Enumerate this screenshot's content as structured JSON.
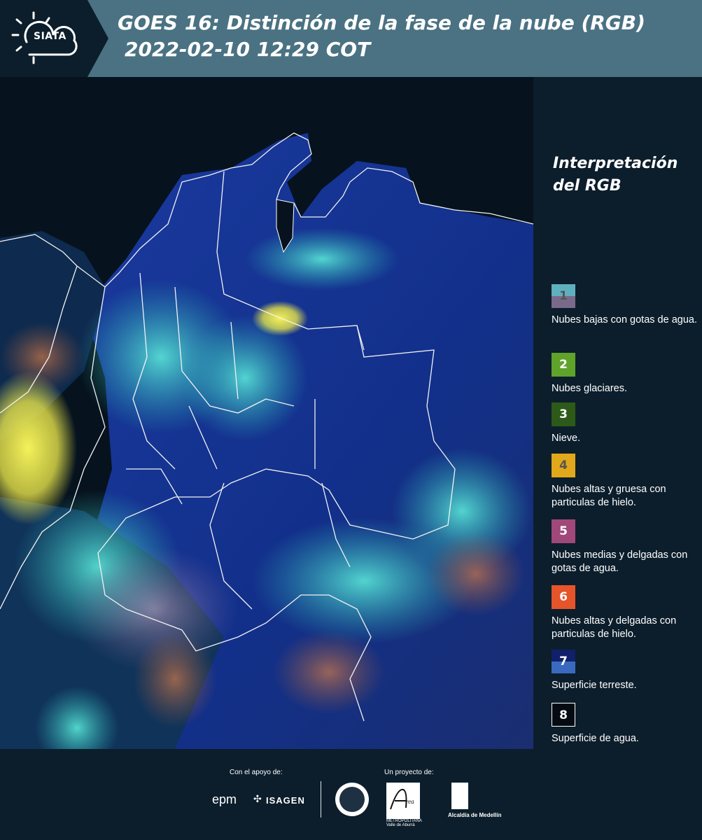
{
  "header": {
    "logo_text": "SIATA",
    "title_line1": "GOES 16: Distinción de la fase de la nube (RGB)",
    "title_line2": "2022-02-10 12:29 COT"
  },
  "legend": {
    "title_line1": "Interpretación",
    "title_line2": "del RGB",
    "items": [
      {
        "num": "1",
        "desc": "Nubes bajas con gotas de agua.",
        "color_top": "#5fb0bf",
        "color_bottom": "#7a6a8a",
        "num_color": "#555555"
      },
      {
        "num": "2",
        "desc": "Nubes glaciares.",
        "color_top": "#5fa32a",
        "color_bottom": "#5fa32a",
        "num_color": "#ffffff"
      },
      {
        "num": "3",
        "desc": "Nieve.",
        "color_top": "#2d5a18",
        "color_bottom": "#2d5a18",
        "num_color": "#ffffff"
      },
      {
        "num": "4",
        "desc": "Nubes altas y gruesa con particulas de hielo.",
        "color_top": "#e0a81a",
        "color_bottom": "#e0a81a",
        "num_color": "#555555"
      },
      {
        "num": "5",
        "desc": "Nubes medias y delgadas con gotas de agua.",
        "color_top": "#a0487a",
        "color_bottom": "#a0487a",
        "num_color": "#ffffff"
      },
      {
        "num": "6",
        "desc": "Nubes altas y delgadas con particulas de hielo.",
        "color_top": "#e6542a",
        "color_bottom": "#e6542a",
        "num_color": "#ffffff"
      },
      {
        "num": "7",
        "desc": "Superficie terreste.",
        "color_top": "#10206a",
        "color_bottom": "#3a6ac0",
        "num_color": "#ffffff"
      },
      {
        "num": "8",
        "desc": "Superficie de agua.",
        "color_top": "#050b12",
        "color_bottom": "#050b12",
        "num_color": "#ffffff"
      }
    ]
  },
  "footer": {
    "support_label": "Con el apoyo de:",
    "project_label": "Un proyecto de:",
    "sponsor_epm": "epm",
    "sponsor_isagen": "ISAGEN",
    "amva_caption": "METROPOLITANA Valle de Aburrá",
    "alcaldia_label": "Alcaldía de Medellín"
  }
}
